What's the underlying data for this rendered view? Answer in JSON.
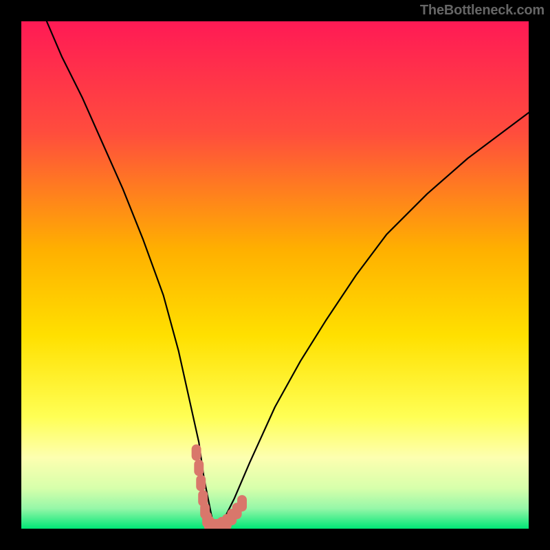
{
  "watermark": "TheBottleneck.com",
  "chart_data": {
    "type": "line",
    "title": "",
    "xlabel": "",
    "ylabel": "",
    "xlim": [
      0,
      100
    ],
    "ylim": [
      0,
      100
    ],
    "grid": false,
    "legend": false,
    "background_gradient": {
      "top": "#ff1a55",
      "mid_upper": "#ff7a2a",
      "mid": "#ffde00",
      "mid_lower": "#ffff66",
      "bottom": "#00e676"
    },
    "series": [
      {
        "name": "bottleneck-curve",
        "description": "V-shaped curve showing bottleneck dipping to 0 around x≈38 then rising; left branch steeper than right.",
        "x": [
          5,
          8,
          12,
          16,
          20,
          24,
          28,
          31,
          33,
          35,
          36,
          37,
          38,
          39,
          40,
          42,
          45,
          50,
          55,
          60,
          66,
          72,
          80,
          88,
          96,
          100
        ],
        "values": [
          100,
          93,
          85,
          76,
          67,
          57,
          46,
          35,
          26,
          17,
          10,
          5,
          0,
          0,
          2,
          6,
          13,
          24,
          33,
          41,
          50,
          58,
          66,
          73,
          79,
          82
        ]
      }
    ],
    "marker_groups": [
      {
        "name": "highlight-left",
        "color": "#d9776b",
        "points": [
          {
            "x": 34.5,
            "y": 15
          },
          {
            "x": 35.0,
            "y": 12
          },
          {
            "x": 35.4,
            "y": 9
          },
          {
            "x": 35.8,
            "y": 6
          },
          {
            "x": 36.2,
            "y": 3.5
          },
          {
            "x": 36.6,
            "y": 1.8
          },
          {
            "x": 37.0,
            "y": 1
          }
        ]
      },
      {
        "name": "highlight-bottom",
        "color": "#d9776b",
        "points": [
          {
            "x": 37.5,
            "y": 0.5
          },
          {
            "x": 38.5,
            "y": 0.3
          },
          {
            "x": 39.5,
            "y": 0.7
          },
          {
            "x": 40.5,
            "y": 1.3
          },
          {
            "x": 41.5,
            "y": 2.3
          },
          {
            "x": 42.5,
            "y": 3.5
          },
          {
            "x": 43.5,
            "y": 5.0
          }
        ]
      }
    ]
  }
}
